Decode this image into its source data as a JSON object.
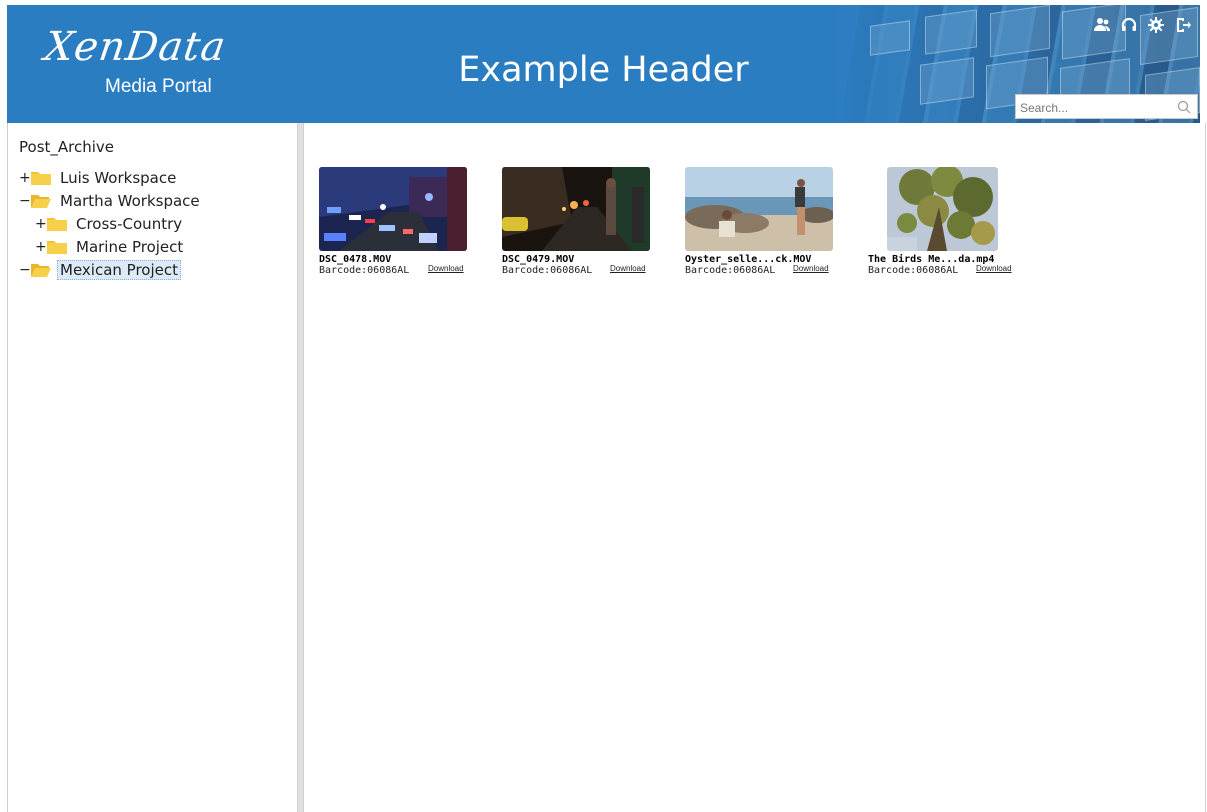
{
  "header": {
    "logo_main": "XenData",
    "logo_sub": "Media Portal",
    "title": "Example Header",
    "search_placeholder": "Search...",
    "icons": [
      "users-icon",
      "support-headset-icon",
      "gear-icon",
      "logout-icon"
    ],
    "bg_color": "#2b7dc2"
  },
  "tree": {
    "root": "Post_Archive",
    "items": [
      {
        "label": "Luis Workspace",
        "toggle": "+",
        "level": 0,
        "open": false
      },
      {
        "label": "Martha Workspace",
        "toggle": "−",
        "level": 0,
        "open": true
      },
      {
        "label": "Cross-Country",
        "toggle": "+",
        "level": 1,
        "open": false
      },
      {
        "label": "Marine Project",
        "toggle": "+",
        "level": 1,
        "open": false
      },
      {
        "label": "Mexican Project",
        "toggle": "−",
        "level": 0,
        "open": true,
        "selected": true
      }
    ]
  },
  "files": [
    {
      "name": "DSC_0478.MOV",
      "barcode": "Barcode:06086AL",
      "download": "Download",
      "thumb": "night-street-police-lights"
    },
    {
      "name": "DSC_0479.MOV",
      "barcode": "Barcode:06086AL",
      "download": "Download",
      "thumb": "night-street-pedestrian"
    },
    {
      "name": "Oyster_selle...ck.MOV",
      "barcode": "Barcode:06086AL",
      "download": "Download",
      "thumb": "beach-rocks-people"
    },
    {
      "name": "The Birds Me...da.mp4",
      "barcode": "Barcode:06086AL",
      "download": "Download",
      "thumb": "tree-branches-sky"
    }
  ]
}
